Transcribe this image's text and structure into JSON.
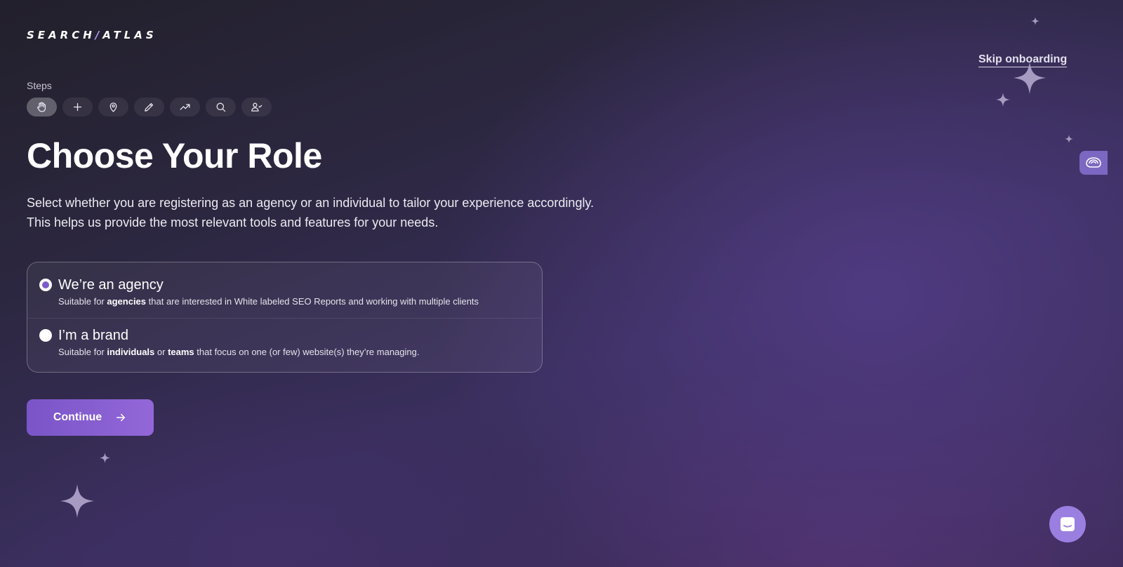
{
  "app": {
    "logo_left": "SEARCH",
    "logo_slash": "/",
    "logo_right": "ATLAS",
    "skip_label": "Skip onboarding"
  },
  "steps": {
    "label": "Steps",
    "items": [
      {
        "icon": "hand-wave-icon",
        "active": true
      },
      {
        "icon": "plus-icon",
        "active": false
      },
      {
        "icon": "location-pin-icon",
        "active": false
      },
      {
        "icon": "pencil-icon",
        "active": false
      },
      {
        "icon": "trending-up-icon",
        "active": false
      },
      {
        "icon": "search-icon",
        "active": false
      },
      {
        "icon": "users-icon",
        "active": false
      }
    ]
  },
  "main": {
    "title": "Choose Your Role",
    "description_line1": "Select whether you are registering as an agency or an individual to tailor your experience accordingly.",
    "description_line2": "This helps us provide the most relevant tools and features for your needs."
  },
  "roles": [
    {
      "title": "We’re an agency",
      "selected": true,
      "sub_prefix": "Suitable for ",
      "sub_bold1": "agencies",
      "sub_suffix": " that are interested in White labeled SEO Reports and working with multiple clients"
    },
    {
      "title": "I’m a brand",
      "selected": false,
      "sub_prefix": "Suitable for ",
      "sub_bold1": "individuals",
      "sub_mid": " or ",
      "sub_bold2": "teams",
      "sub_suffix": " that focus on one (or few) website(s) they’re managing."
    }
  ],
  "actions": {
    "continue_label": "Continue"
  },
  "colors": {
    "accent": "#8a60d2",
    "radio_dot": "#7a5cc9",
    "chat_bubble": "#9b7fe0"
  }
}
